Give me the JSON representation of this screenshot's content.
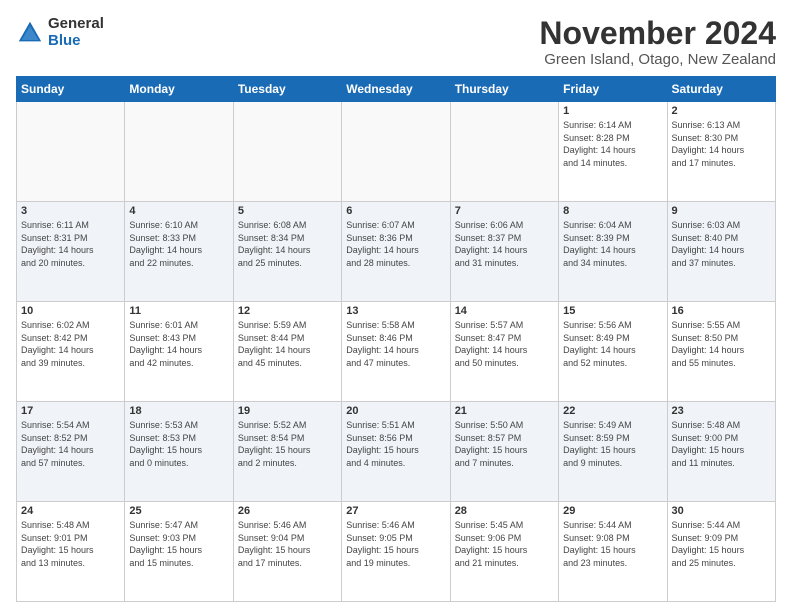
{
  "logo": {
    "general": "General",
    "blue": "Blue"
  },
  "title": "November 2024",
  "location": "Green Island, Otago, New Zealand",
  "weekdays": [
    "Sunday",
    "Monday",
    "Tuesday",
    "Wednesday",
    "Thursday",
    "Friday",
    "Saturday"
  ],
  "weeks": [
    [
      {
        "day": "",
        "info": ""
      },
      {
        "day": "",
        "info": ""
      },
      {
        "day": "",
        "info": ""
      },
      {
        "day": "",
        "info": ""
      },
      {
        "day": "",
        "info": ""
      },
      {
        "day": "1",
        "info": "Sunrise: 6:14 AM\nSunset: 8:28 PM\nDaylight: 14 hours\nand 14 minutes."
      },
      {
        "day": "2",
        "info": "Sunrise: 6:13 AM\nSunset: 8:30 PM\nDaylight: 14 hours\nand 17 minutes."
      }
    ],
    [
      {
        "day": "3",
        "info": "Sunrise: 6:11 AM\nSunset: 8:31 PM\nDaylight: 14 hours\nand 20 minutes."
      },
      {
        "day": "4",
        "info": "Sunrise: 6:10 AM\nSunset: 8:33 PM\nDaylight: 14 hours\nand 22 minutes."
      },
      {
        "day": "5",
        "info": "Sunrise: 6:08 AM\nSunset: 8:34 PM\nDaylight: 14 hours\nand 25 minutes."
      },
      {
        "day": "6",
        "info": "Sunrise: 6:07 AM\nSunset: 8:36 PM\nDaylight: 14 hours\nand 28 minutes."
      },
      {
        "day": "7",
        "info": "Sunrise: 6:06 AM\nSunset: 8:37 PM\nDaylight: 14 hours\nand 31 minutes."
      },
      {
        "day": "8",
        "info": "Sunrise: 6:04 AM\nSunset: 8:39 PM\nDaylight: 14 hours\nand 34 minutes."
      },
      {
        "day": "9",
        "info": "Sunrise: 6:03 AM\nSunset: 8:40 PM\nDaylight: 14 hours\nand 37 minutes."
      }
    ],
    [
      {
        "day": "10",
        "info": "Sunrise: 6:02 AM\nSunset: 8:42 PM\nDaylight: 14 hours\nand 39 minutes."
      },
      {
        "day": "11",
        "info": "Sunrise: 6:01 AM\nSunset: 8:43 PM\nDaylight: 14 hours\nand 42 minutes."
      },
      {
        "day": "12",
        "info": "Sunrise: 5:59 AM\nSunset: 8:44 PM\nDaylight: 14 hours\nand 45 minutes."
      },
      {
        "day": "13",
        "info": "Sunrise: 5:58 AM\nSunset: 8:46 PM\nDaylight: 14 hours\nand 47 minutes."
      },
      {
        "day": "14",
        "info": "Sunrise: 5:57 AM\nSunset: 8:47 PM\nDaylight: 14 hours\nand 50 minutes."
      },
      {
        "day": "15",
        "info": "Sunrise: 5:56 AM\nSunset: 8:49 PM\nDaylight: 14 hours\nand 52 minutes."
      },
      {
        "day": "16",
        "info": "Sunrise: 5:55 AM\nSunset: 8:50 PM\nDaylight: 14 hours\nand 55 minutes."
      }
    ],
    [
      {
        "day": "17",
        "info": "Sunrise: 5:54 AM\nSunset: 8:52 PM\nDaylight: 14 hours\nand 57 minutes."
      },
      {
        "day": "18",
        "info": "Sunrise: 5:53 AM\nSunset: 8:53 PM\nDaylight: 15 hours\nand 0 minutes."
      },
      {
        "day": "19",
        "info": "Sunrise: 5:52 AM\nSunset: 8:54 PM\nDaylight: 15 hours\nand 2 minutes."
      },
      {
        "day": "20",
        "info": "Sunrise: 5:51 AM\nSunset: 8:56 PM\nDaylight: 15 hours\nand 4 minutes."
      },
      {
        "day": "21",
        "info": "Sunrise: 5:50 AM\nSunset: 8:57 PM\nDaylight: 15 hours\nand 7 minutes."
      },
      {
        "day": "22",
        "info": "Sunrise: 5:49 AM\nSunset: 8:59 PM\nDaylight: 15 hours\nand 9 minutes."
      },
      {
        "day": "23",
        "info": "Sunrise: 5:48 AM\nSunset: 9:00 PM\nDaylight: 15 hours\nand 11 minutes."
      }
    ],
    [
      {
        "day": "24",
        "info": "Sunrise: 5:48 AM\nSunset: 9:01 PM\nDaylight: 15 hours\nand 13 minutes."
      },
      {
        "day": "25",
        "info": "Sunrise: 5:47 AM\nSunset: 9:03 PM\nDaylight: 15 hours\nand 15 minutes."
      },
      {
        "day": "26",
        "info": "Sunrise: 5:46 AM\nSunset: 9:04 PM\nDaylight: 15 hours\nand 17 minutes."
      },
      {
        "day": "27",
        "info": "Sunrise: 5:46 AM\nSunset: 9:05 PM\nDaylight: 15 hours\nand 19 minutes."
      },
      {
        "day": "28",
        "info": "Sunrise: 5:45 AM\nSunset: 9:06 PM\nDaylight: 15 hours\nand 21 minutes."
      },
      {
        "day": "29",
        "info": "Sunrise: 5:44 AM\nSunset: 9:08 PM\nDaylight: 15 hours\nand 23 minutes."
      },
      {
        "day": "30",
        "info": "Sunrise: 5:44 AM\nSunset: 9:09 PM\nDaylight: 15 hours\nand 25 minutes."
      }
    ]
  ]
}
